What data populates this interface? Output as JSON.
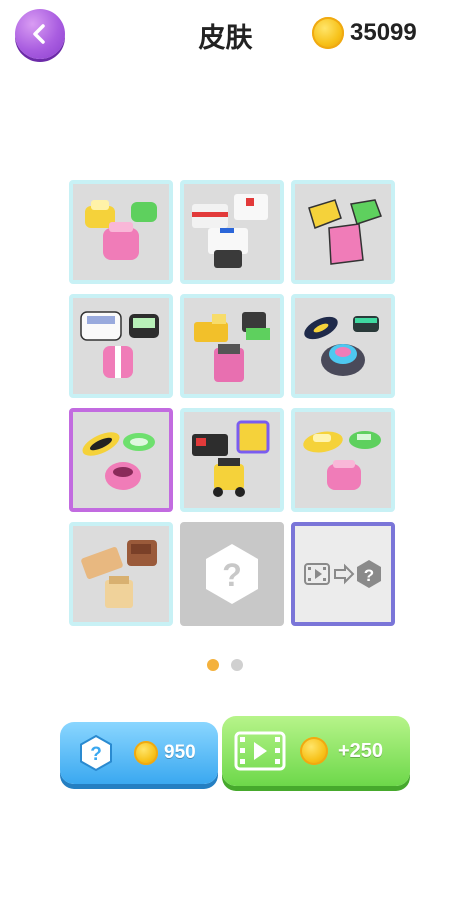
{
  "header": {
    "title": "皮肤",
    "coin_balance": "35099",
    "back_icon": "chevron-left-icon",
    "coin_icon": "coin-icon"
  },
  "skins": [
    {
      "id": "skin-1",
      "state": "owned"
    },
    {
      "id": "skin-2",
      "state": "owned"
    },
    {
      "id": "skin-3",
      "state": "owned"
    },
    {
      "id": "skin-4",
      "state": "owned"
    },
    {
      "id": "skin-5",
      "state": "owned"
    },
    {
      "id": "skin-6",
      "state": "owned"
    },
    {
      "id": "skin-7",
      "state": "selected"
    },
    {
      "id": "skin-8",
      "state": "owned"
    },
    {
      "id": "skin-9",
      "state": "owned"
    },
    {
      "id": "skin-10",
      "state": "owned"
    },
    {
      "id": "skin-11",
      "state": "locked",
      "icon": "question-hexagon-icon"
    },
    {
      "id": "skin-12",
      "state": "video-unlock",
      "icon": "video-to-question-icon"
    }
  ],
  "pagination": {
    "pages": 2,
    "current": 1
  },
  "buttons": {
    "buy_random": {
      "price": "950",
      "icon": "question-hexagon-icon",
      "coin_icon": "coin-icon"
    },
    "watch_ad": {
      "reward": "+250",
      "icon": "film-play-icon",
      "coin_icon": "coin-icon"
    }
  },
  "colors": {
    "accent_purple": "#a95de0",
    "slot_border": "#c8f1f5",
    "selected_border": "#c26be0",
    "blue_button": "#3aa8f0",
    "green_button": "#6dd84a",
    "coin": "#f7c21a",
    "active_dot": "#f4b13c"
  }
}
